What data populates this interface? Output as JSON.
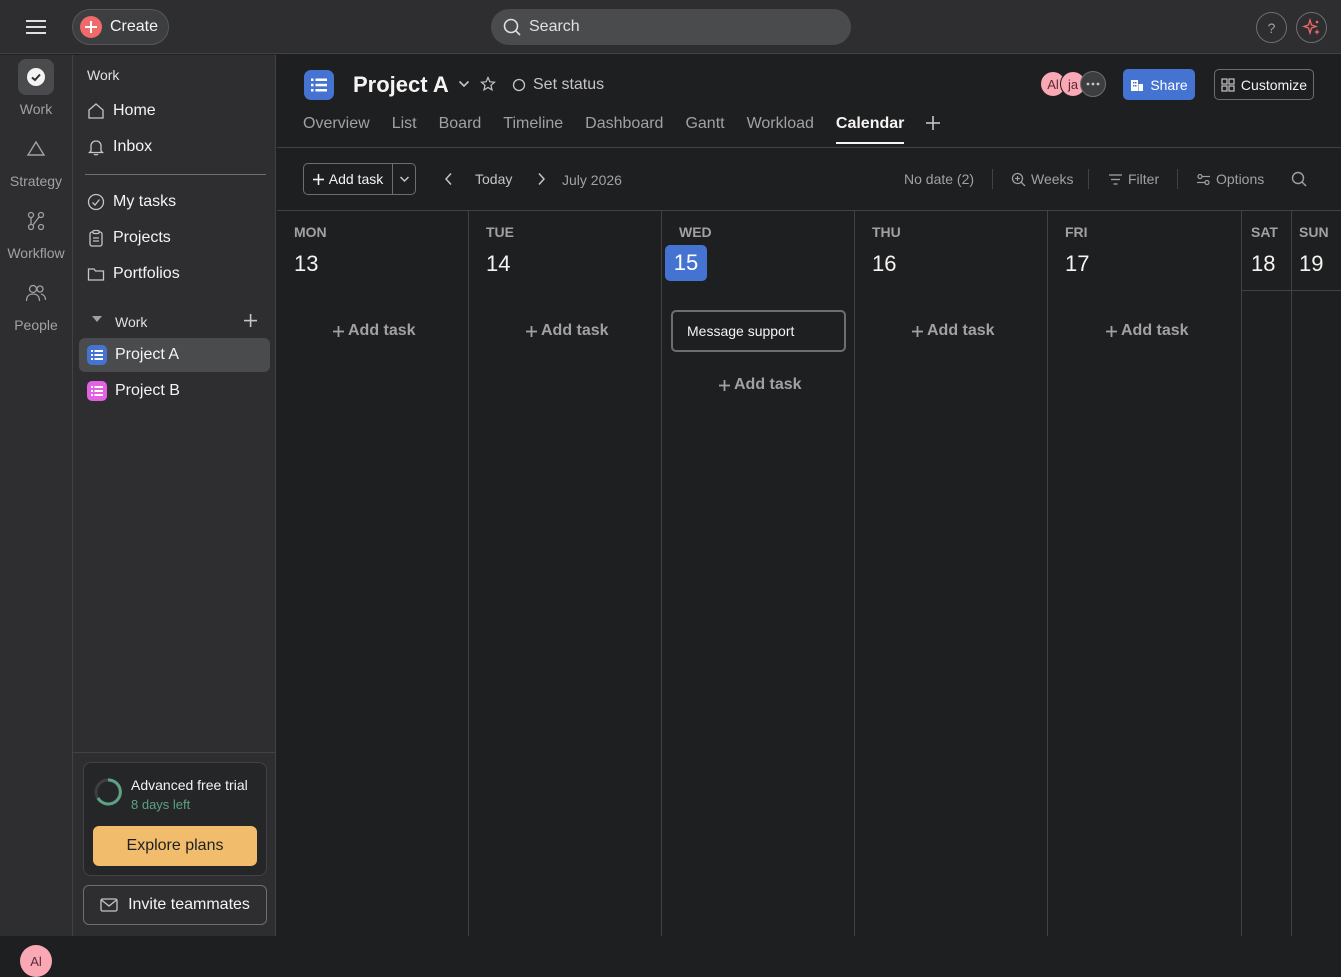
{
  "topbar": {
    "create_label": "Create",
    "search_placeholder": "Search",
    "help_label": "?"
  },
  "rail": {
    "items": [
      {
        "label": "Work",
        "icon": "check-circle-icon"
      },
      {
        "label": "Strategy",
        "icon": "triangle-icon"
      },
      {
        "label": "Workflow",
        "icon": "workflow-icon"
      },
      {
        "label": "People",
        "icon": "people-icon"
      }
    ],
    "avatar_initials": "Al"
  },
  "sidebar": {
    "heading": "Work",
    "home": "Home",
    "inbox": "Inbox",
    "my_tasks": "My tasks",
    "projects": "Projects",
    "portfolios": "Portfolios",
    "section_title": "Work",
    "project_a": "Project A",
    "project_b": "Project B",
    "trial_title": "Advanced free trial",
    "trial_days": "8 days left",
    "explore_label": "Explore plans",
    "invite_label": "Invite teammates"
  },
  "header": {
    "project_title": "Project A",
    "set_status": "Set status",
    "avatars": [
      "Al",
      "ja"
    ],
    "share_label": "Share",
    "customize_label": "Customize",
    "tabs": [
      "Overview",
      "List",
      "Board",
      "Timeline",
      "Dashboard",
      "Gantt",
      "Workload",
      "Calendar"
    ],
    "active_tab": "Calendar"
  },
  "toolbar": {
    "add_task": "Add task",
    "today": "Today",
    "month": "July 2026",
    "no_date": "No date (2)",
    "weeks": "Weeks",
    "filter": "Filter",
    "options": "Options"
  },
  "calendar": {
    "days": [
      {
        "name": "MON",
        "num": "13"
      },
      {
        "name": "TUE",
        "num": "14"
      },
      {
        "name": "WED",
        "num": "15"
      },
      {
        "name": "THU",
        "num": "16"
      },
      {
        "name": "FRI",
        "num": "17"
      },
      {
        "name": "SAT",
        "num": "18"
      },
      {
        "name": "SUN",
        "num": "19"
      }
    ],
    "today_index": 2,
    "add_task_label": "Add task",
    "new_task_value": "Message support"
  },
  "colors": {
    "accent": "#4573d2",
    "create": "#f06a6a",
    "explore": "#f1bd6c",
    "trial_green": "#5da283"
  }
}
